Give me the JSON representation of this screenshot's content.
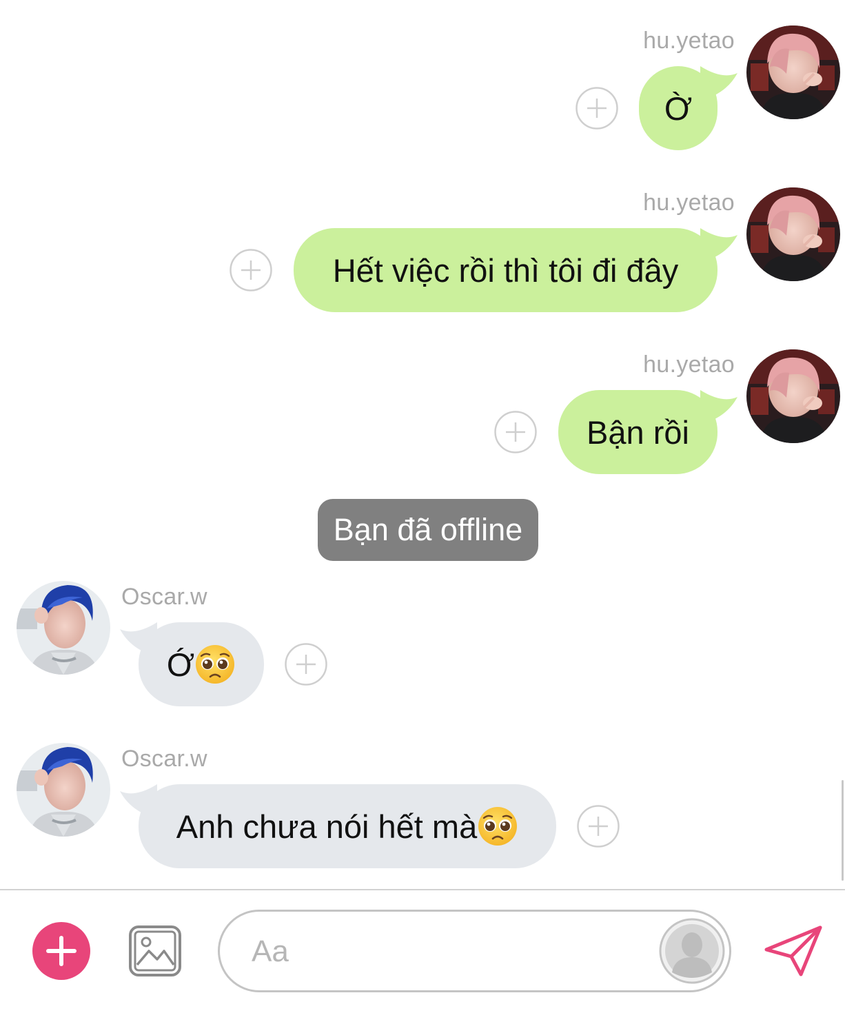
{
  "messages": [
    {
      "sender": "hu.yetao",
      "direction": "outgoing",
      "text": "Ờ"
    },
    {
      "sender": "hu.yetao",
      "direction": "outgoing",
      "text": "Hết việc rồi thì tôi đi đây"
    },
    {
      "sender": "hu.yetao",
      "direction": "outgoing",
      "text": "Bận rồi"
    },
    {
      "sender": "Oscar.w",
      "direction": "incoming",
      "text": "Ớ",
      "emoji": "pleading-face"
    },
    {
      "sender": "Oscar.w",
      "direction": "incoming",
      "text": "Anh chưa nói hết mà",
      "emoji": "pleading-face"
    }
  ],
  "system_notice": "Bạn đã offline",
  "composer": {
    "placeholder": "Aa"
  },
  "icons": {
    "add": "plus-circle-icon",
    "gallery": "image-icon",
    "profile": "person-icon",
    "send": "paper-plane-icon",
    "react": "add-reaction-icon"
  },
  "colors": {
    "outgoing_bubble": "#cbf09c",
    "incoming_bubble": "#e5e8ec",
    "notice_bg": "#808080",
    "accent": "#e8457a"
  }
}
